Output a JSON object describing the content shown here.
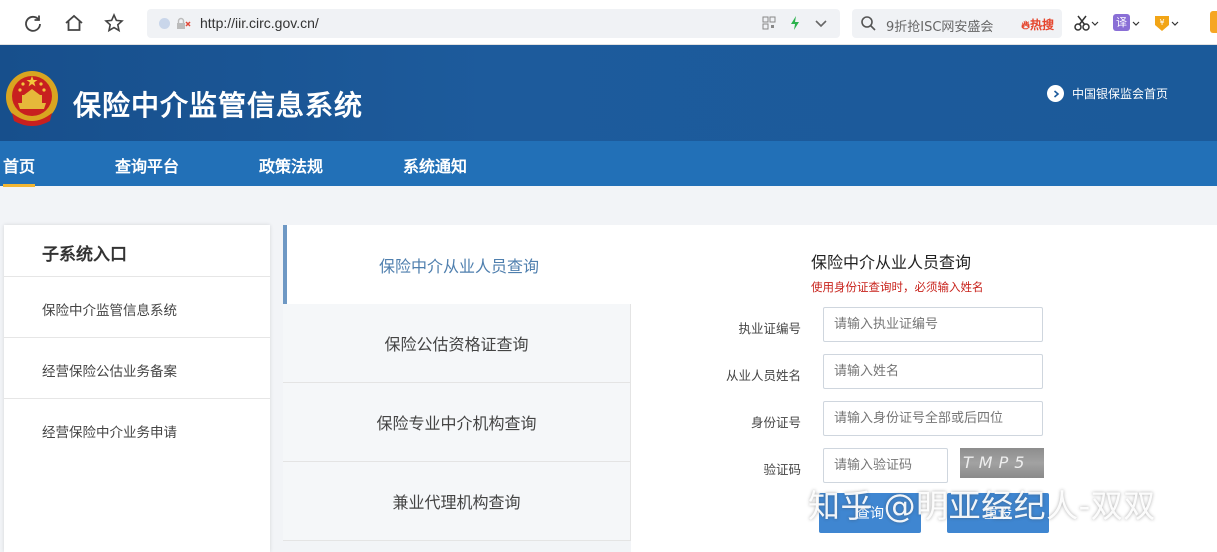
{
  "browser": {
    "url": "http://iir.circ.gov.cn/",
    "search_text": "9折抢ISC网安盛会",
    "hot_label": "热搜",
    "translate_label": "译"
  },
  "header": {
    "title": "保险中介监管信息系统",
    "home_link": "中国银保监会首页"
  },
  "nav": {
    "items": [
      {
        "label": "首页"
      },
      {
        "label": "查询平台"
      },
      {
        "label": "政策法规"
      },
      {
        "label": "系统通知"
      }
    ]
  },
  "sidebar": {
    "title": "子系统入口",
    "items": [
      {
        "label": "保险中介监管信息系统"
      },
      {
        "label": "经营保险公估业务备案"
      },
      {
        "label": "经营保险中介业务申请"
      }
    ]
  },
  "tabs": [
    {
      "label": "保险中介从业人员查询"
    },
    {
      "label": "保险公估资格证查询"
    },
    {
      "label": "保险专业中介机构查询"
    },
    {
      "label": "兼业代理机构查询"
    }
  ],
  "form": {
    "title": "保险中介从业人员查询",
    "hint": "使用身份证查询时，必须输入姓名",
    "fields": [
      {
        "label": "执业证编号",
        "placeholder": "请输入执业证编号"
      },
      {
        "label": "从业人员姓名",
        "placeholder": "请输入姓名"
      },
      {
        "label": "身份证号",
        "placeholder": "请输入身份证号全部或后四位"
      },
      {
        "label": "验证码",
        "placeholder": "请输入验证码"
      }
    ],
    "captcha": "TMP5",
    "query_button": "查询",
    "reset_button": "重设"
  },
  "watermark": "知乎 @明亚经纪人-双双",
  "colors": {
    "header_bg": "#1d5b9c",
    "nav_bg": "#2270b7",
    "button": "#3f86d1",
    "hint": "#c8231c",
    "nav_active_underline": "#f2b632"
  }
}
